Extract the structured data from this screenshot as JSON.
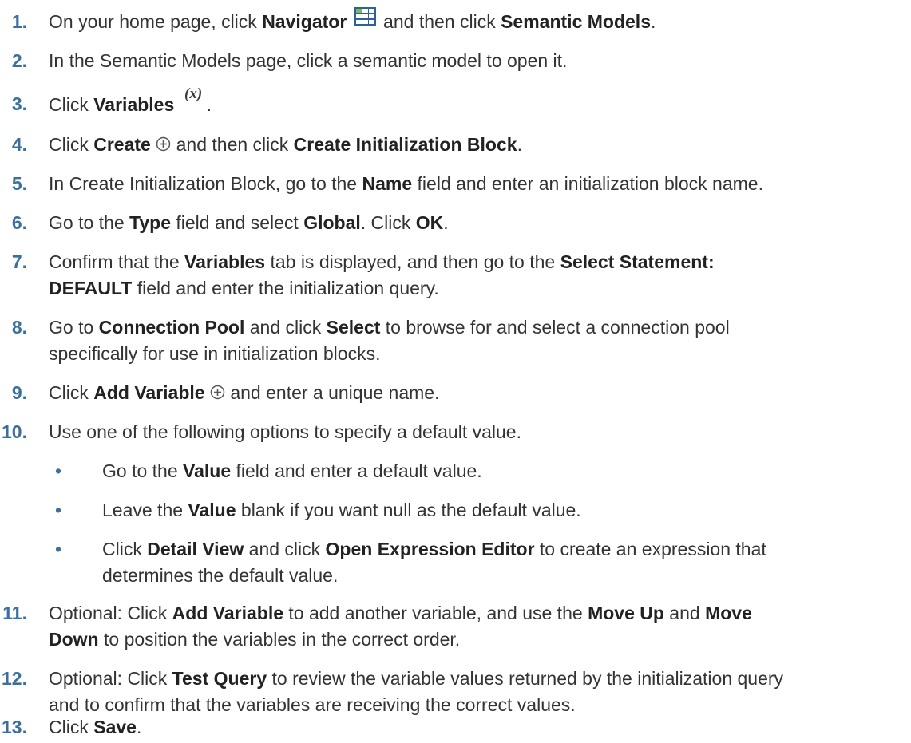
{
  "steps": [
    {
      "num": "1.",
      "t1": "On your home page, click ",
      "b1": "Navigator",
      "t2": " and then click ",
      "b2": "Semantic Models",
      "t3": "."
    },
    {
      "num": "2.",
      "t1": "In the Semantic Models page, click a semantic model to open it."
    },
    {
      "num": "3.",
      "t1": "Click ",
      "b1": "Variables",
      "t2": "."
    },
    {
      "num": "4.",
      "t1": "Click ",
      "b1": "Create",
      "t2": " and then click ",
      "b2": "Create Initialization Block",
      "t3": "."
    },
    {
      "num": "5.",
      "t1": "In Create Initialization Block, go to the ",
      "b1": "Name",
      "t2": " field and enter an initialization block name."
    },
    {
      "num": "6.",
      "t1": "Go to the ",
      "b1": "Type",
      "t2": " field and select ",
      "b2": "Global",
      "t3": ". Click ",
      "b3": "OK",
      "t4": "."
    },
    {
      "num": "7.",
      "t1": "Confirm that the ",
      "b1": "Variables",
      "t2": " tab is displayed, and then go to the ",
      "b2": "Select Statement:",
      "b3": "DEFAULT",
      "t3": " field and enter the initialization query."
    },
    {
      "num": "8.",
      "t1": "Go to ",
      "b1": "Connection Pool",
      "t2": " and click ",
      "b2": "Select",
      "t3": " to browse for and select a connection pool",
      "t4": "specifically for use in initialization blocks."
    },
    {
      "num": "9.",
      "t1": "Click ",
      "b1": "Add Variable",
      "t2": " and enter a unique name."
    },
    {
      "num": "10.",
      "t1": "Use one of the following options to specify a default value."
    },
    {
      "num": "11.",
      "t1": "Optional: Click ",
      "b1": "Add Variable",
      "t2": " to add another variable, and use the ",
      "b2": "Move Up",
      "t3": " and ",
      "b3": "Move",
      "b4": "Down",
      "t4": " to position the variables in the correct order."
    },
    {
      "num": "12.",
      "t1": "Optional: Click ",
      "b1": "Test Query",
      "t2": " to review the variable values returned by the initialization query",
      "t3": "and to confirm that the variables are receiving the correct values."
    },
    {
      "num": "13.",
      "t1": "Click ",
      "b1": "Save",
      "t2": "."
    }
  ],
  "bullets": [
    {
      "dot": "•",
      "t1": "Go to the ",
      "b1": "Value",
      "t2": " field and enter a default value."
    },
    {
      "dot": "•",
      "t1": "Leave the ",
      "b1": "Value",
      "t2": " blank if you want null as the default value."
    },
    {
      "dot": "•",
      "t1": "Click ",
      "b1": "Detail View",
      "t2": " and click ",
      "b2": "Open Expression Editor",
      "t3": " to create an expression that",
      "t4": "determines the default value."
    }
  ],
  "icons": {
    "navigator": "grid-icon",
    "variables": "variables-x-icon",
    "create": "add-circle-icon",
    "add_variable": "add-circle-icon"
  },
  "colors": {
    "step_number": "#3a6f9e",
    "body_text": "#333333",
    "grid_icon_blue": "#2e5f9e",
    "grid_icon_green": "#7bbd4a"
  }
}
